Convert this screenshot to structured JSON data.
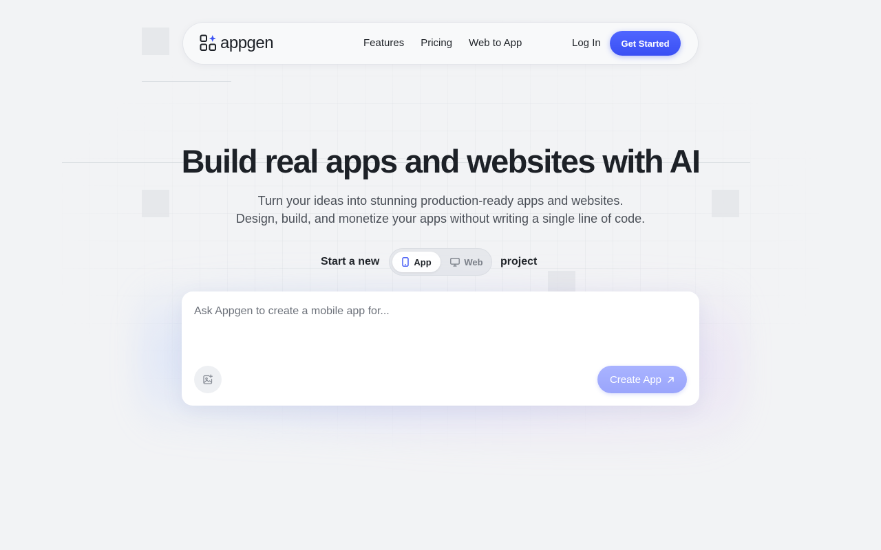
{
  "brand": {
    "name": "appgen",
    "icon": "appgen-logo-icon",
    "accent": "#3d54f5"
  },
  "nav": {
    "links": [
      "Features",
      "Pricing",
      "Web to App"
    ],
    "login_label": "Log In",
    "cta_label": "Get Started"
  },
  "hero": {
    "headline": "Build real apps and websites with AI",
    "subline_1": "Turn your ideas into stunning production-ready apps and websites.",
    "subline_2": "Design, build, and monetize your apps without writing a single line of code."
  },
  "mode": {
    "prefix": "Start a new",
    "suffix": "project",
    "options": [
      {
        "label": "App",
        "icon": "smartphone-icon",
        "selected": true
      },
      {
        "label": "Web",
        "icon": "monitor-icon",
        "selected": false
      }
    ]
  },
  "prompt": {
    "placeholder": "Ask Appgen to create a mobile app for...",
    "value": "",
    "attach_icon": "image-plus-icon",
    "submit_label": "Create App",
    "submit_icon": "arrow-up-right-icon"
  }
}
